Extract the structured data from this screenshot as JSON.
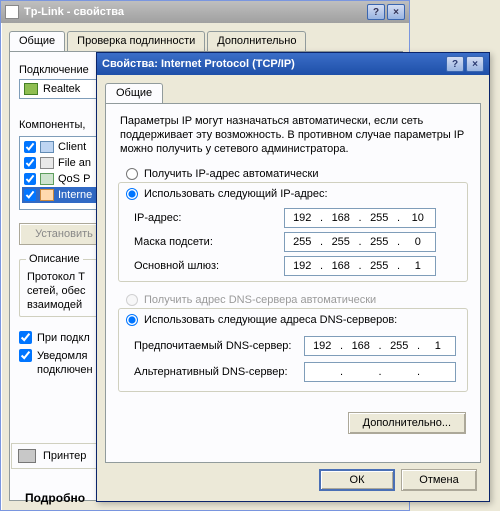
{
  "bg": {
    "title": "Tp-Link - свойства",
    "tabs": [
      "Общие",
      "Проверка подлинности",
      "Дополнительно"
    ],
    "connect_label": "Подключение",
    "nic": "Realtek",
    "components_label": "Компоненты, ",
    "list": [
      {
        "checked": true,
        "label": "Client "
      },
      {
        "checked": true,
        "label": "File an"
      },
      {
        "checked": true,
        "label": "QoS P"
      },
      {
        "checked": true,
        "label": "Interne"
      }
    ],
    "install_btn": "Установить",
    "group_desc_title": "Описание",
    "desc_lines": [
      "Протокол T",
      "сетей, обес",
      "взаимодей"
    ],
    "check_connect": "При подкл",
    "check_notify": "Уведомля",
    "notify_sub": "подключен",
    "printer": "Принтер",
    "details": "Подробно"
  },
  "fg": {
    "title": "Свойства: Internet Protocol (TCP/IP)",
    "tab_general": "Общие",
    "desc": "Параметры IP могут назначаться автоматически, если сеть поддерживает эту возможность. В противном случае параметры IP можно получить у сетевого администратора.",
    "radio_auto_ip": "Получить IP-адрес автоматически",
    "radio_manual_ip": "Использовать следующий IP-адрес:",
    "lbl_ip": "IP-адрес:",
    "lbl_mask": "Маска подсети:",
    "lbl_gateway": "Основной шлюз:",
    "ip": [
      "192",
      "168",
      "255",
      "10"
    ],
    "mask": [
      "255",
      "255",
      "255",
      "0"
    ],
    "gateway": [
      "192",
      "168",
      "255",
      "1"
    ],
    "radio_auto_dns": "Получить адрес DNS-сервера автоматически",
    "radio_manual_dns": "Использовать следующие адреса DNS-серверов:",
    "lbl_dns1": "Предпочитаемый DNS-сервер:",
    "lbl_dns2": "Альтернативный DNS-сервер:",
    "dns1": [
      "192",
      "168",
      "255",
      "1"
    ],
    "dns2": [
      "",
      "",
      "",
      ""
    ],
    "advanced_btn": "Дополнительно...",
    "ok": "ОК",
    "cancel": "Отмена"
  }
}
